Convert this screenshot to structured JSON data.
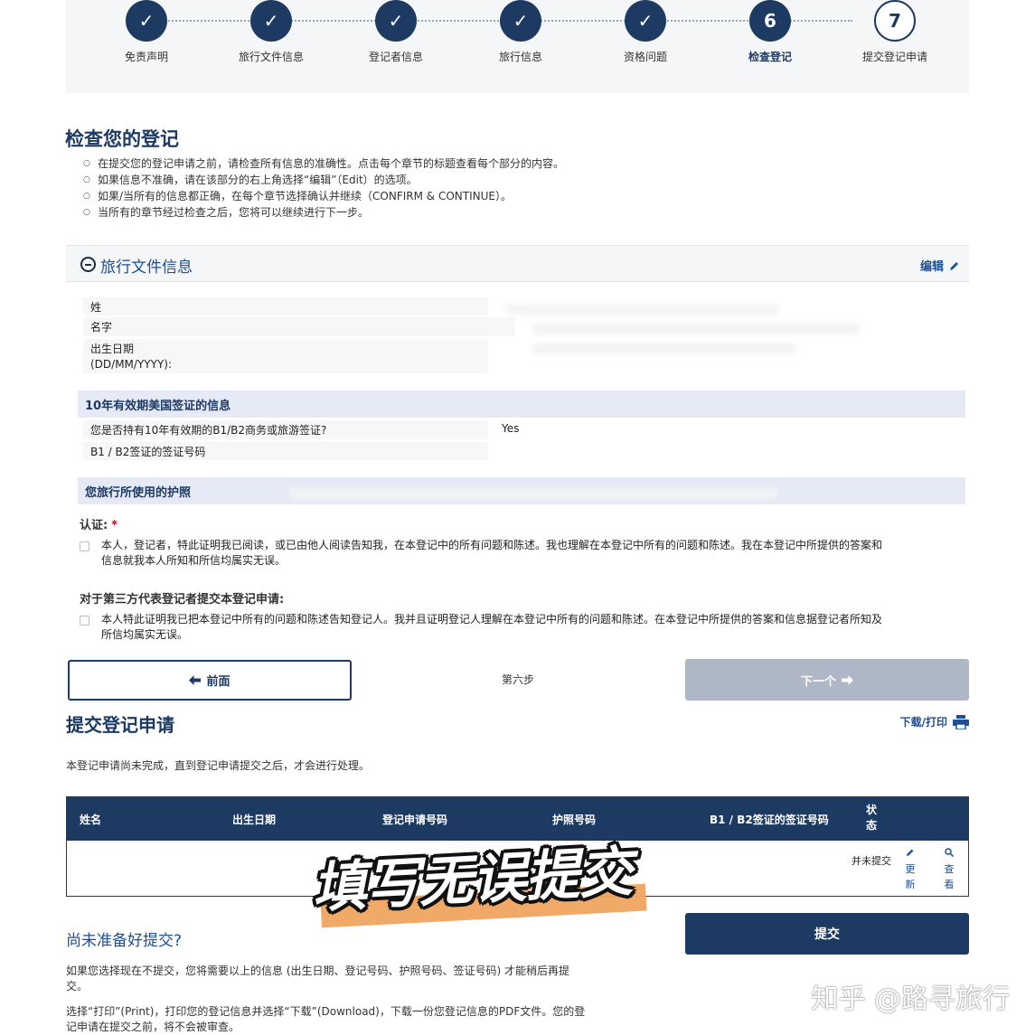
{
  "stepper": {
    "steps": [
      {
        "marker": "✓",
        "label": "免责声明"
      },
      {
        "marker": "✓",
        "label": "旅行文件信息"
      },
      {
        "marker": "✓",
        "label": "登记者信息"
      },
      {
        "marker": "✓",
        "label": "旅行信息"
      },
      {
        "marker": "✓",
        "label": "资格问题"
      },
      {
        "marker": "6",
        "label": "检查登记"
      },
      {
        "marker": "7",
        "label": "提交登记申请"
      }
    ]
  },
  "review": {
    "title": "检查您的登记",
    "bullets": [
      "在提交您的登记申请之前，请检查所有信息的准确性。点击每个章节的标题查看每个部分的内容。",
      "如果信息不准确，请在该部分的右上角选择“编辑”（Edit）的选项。",
      "如果/当所有的信息都正确，在每个章节选择确认并继续（CONFIRM & CONTINUE）。",
      "当所有的章节经过检查之后，您将可以继续进行下一步。"
    ]
  },
  "section": {
    "title": "旅行文件信息",
    "edit_label": "编辑",
    "fields": {
      "surname": "姓",
      "given_name": "名字",
      "dob_line1": "出生日期",
      "dob_line2": "(DD/MM/YYYY):"
    },
    "visa_heading": "10年有效期美国签证的信息",
    "visa_question": "您是否持有10年有效期的B1/B2商务或旅游签证?",
    "visa_answer": "Yes",
    "visa_number_label": "B1 / B2签证的签证号码",
    "passport_heading": "您旅行所使用的护照"
  },
  "certification": {
    "label": "认证:",
    "required_mark": "*",
    "self_text": "本人，登记者，特此证明我已阅读，或已由他人阅读告知我，在本登记中的所有问题和陈述。我也理解在本登记中所有的问题和陈述。我在本登记中所提供的答案和信息就我本人所知和所信均属实无误。",
    "third_party_label": "对于第三方代表登记者提交本登记申请:",
    "third_party_text": "本人特此证明我已把本登记中所有的问题和陈述告知登记人。我并且证明登记人理解在本登记中所有的问题和陈述。在本登记中所提供的答案和信息据登记者所知及所信均属实无误。"
  },
  "nav": {
    "prev_label": "前面",
    "prev_icon": "arrow-left-icon",
    "step_text": "第六步",
    "next_label": "下一个",
    "next_icon": "arrow-right-icon"
  },
  "submit": {
    "title": "提交登记申请",
    "download_label": "下载/打印",
    "note": "本登记申请尚未完成，直到登记申请提交之后，才会进行处理。",
    "table_headers": [
      "姓名",
      "出生日期",
      "登记申请号码",
      "护照号码",
      "B1 / B2签证的签证号码",
      "状态"
    ],
    "status_value": "并未提交",
    "action_update": "更新",
    "action_view": "查看",
    "button": "提交"
  },
  "overlay_text": "填写无误提交",
  "not_ready": {
    "title": "尚未准备好提交?",
    "para1": "如果您选择现在不提交，您将需要以上的信息 (出生日期、登记号码、护照号码、签证号码) 才能稍后再提交。",
    "para2": "选择“打印”(Print)，打印您的登记信息并选择“下载”(Download)，下载一份您登记信息的PDF文件。您的登记申请在提交之前，将不会被审查。"
  },
  "watermark": "知乎 @路寻旅行",
  "colors": {
    "navy": "#1d3a63",
    "link_blue": "#1d4f91",
    "disabled_gray": "#aeb7c6",
    "subhead_bg": "#e6eaf6",
    "overlay_stripe": "#f0a460"
  }
}
